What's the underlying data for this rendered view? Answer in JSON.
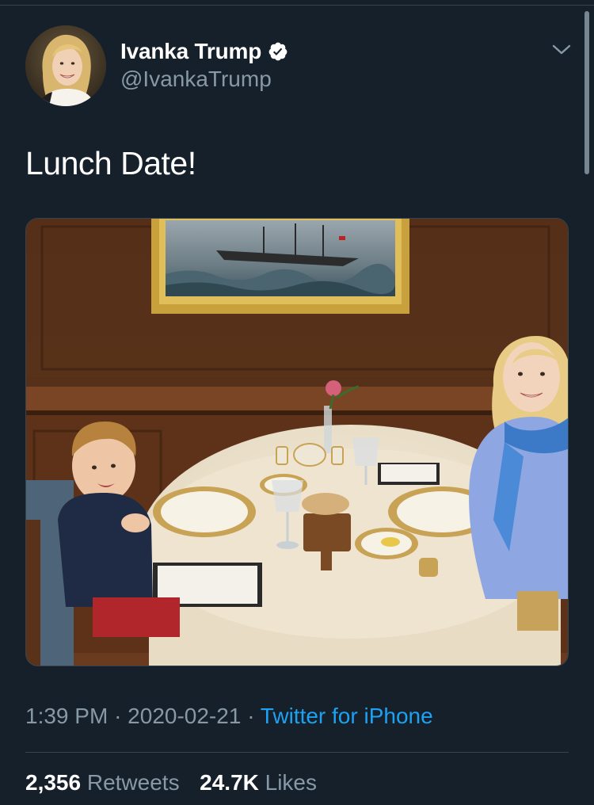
{
  "tweet": {
    "author": {
      "name": "Ivanka Trump",
      "handle": "@IvankaTrump",
      "verified": true,
      "avatar_icon": "avatar-photo"
    },
    "text": "Lunch Date!",
    "timestamp": {
      "time": "1:39 PM",
      "date": "2020-02-21",
      "separator": "·"
    },
    "source": "Twitter for iPhone",
    "stats": {
      "retweets_count": "2,356",
      "retweets_label": "Retweets",
      "likes_count": "24.7K",
      "likes_label": "Likes"
    },
    "menu_icon": "chevron-down-icon"
  },
  "colors": {
    "background": "#15202b",
    "text_primary": "#ffffff",
    "text_secondary": "#8899a6",
    "link": "#1da1f2",
    "divider": "#38444d",
    "verified_badge": "#ffffff"
  }
}
